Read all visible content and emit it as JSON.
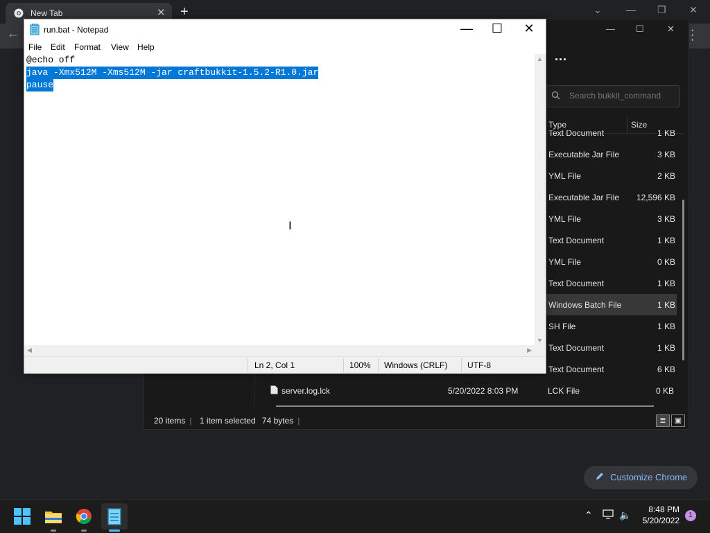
{
  "chrome": {
    "tab_title": "New Tab",
    "customize_label": "Customize Chrome"
  },
  "notepad": {
    "title": "run.bat - Notepad",
    "menu": [
      "File",
      "Edit",
      "Format",
      "View",
      "Help"
    ],
    "lines": [
      {
        "text": "@echo off",
        "selected": false
      },
      {
        "text": "java -Xmx512M -Xms512M -jar craftbukkit-1.5.2-R1.0.jar",
        "selected": true
      },
      {
        "text": "pause",
        "selected": true
      }
    ],
    "status": {
      "position": "Ln 2, Col 1",
      "zoom": "100%",
      "line_ending": "Windows (CRLF)",
      "encoding": "UTF-8"
    }
  },
  "explorer": {
    "search_placeholder": "Search bukkit_command",
    "columns": {
      "type": "Type",
      "size": "Size"
    },
    "rows": [
      {
        "type": "Text Document",
        "size": "1 KB",
        "selected": false
      },
      {
        "type": "Executable Jar File",
        "size": "3 KB",
        "selected": false
      },
      {
        "type": "YML File",
        "size": "2 KB",
        "selected": false
      },
      {
        "type": "Executable Jar File",
        "size": "12,596 KB",
        "selected": false
      },
      {
        "type": "YML File",
        "size": "3 KB",
        "selected": false
      },
      {
        "type": "Text Document",
        "size": "1 KB",
        "selected": false
      },
      {
        "type": "YML File",
        "size": "0 KB",
        "selected": false
      },
      {
        "type": "Text Document",
        "size": "1 KB",
        "selected": false
      },
      {
        "type": "Windows Batch File",
        "size": "1 KB",
        "selected": true
      },
      {
        "type": "SH File",
        "size": "1 KB",
        "selected": false
      },
      {
        "type": "Text Document",
        "size": "1 KB",
        "selected": false
      },
      {
        "type": "Text Document",
        "size": "6 KB",
        "selected": false
      }
    ],
    "bottom_row": {
      "name": "server.log.lck",
      "date": "5/20/2022 8:03 PM",
      "type": "LCK File",
      "size": "0 KB"
    },
    "status": {
      "items": "20 items",
      "selected": "1 item selected",
      "bytes": "74 bytes"
    }
  },
  "taskbar": {
    "time": "8:48 PM",
    "date": "5/20/2022",
    "notification_count": "1"
  }
}
